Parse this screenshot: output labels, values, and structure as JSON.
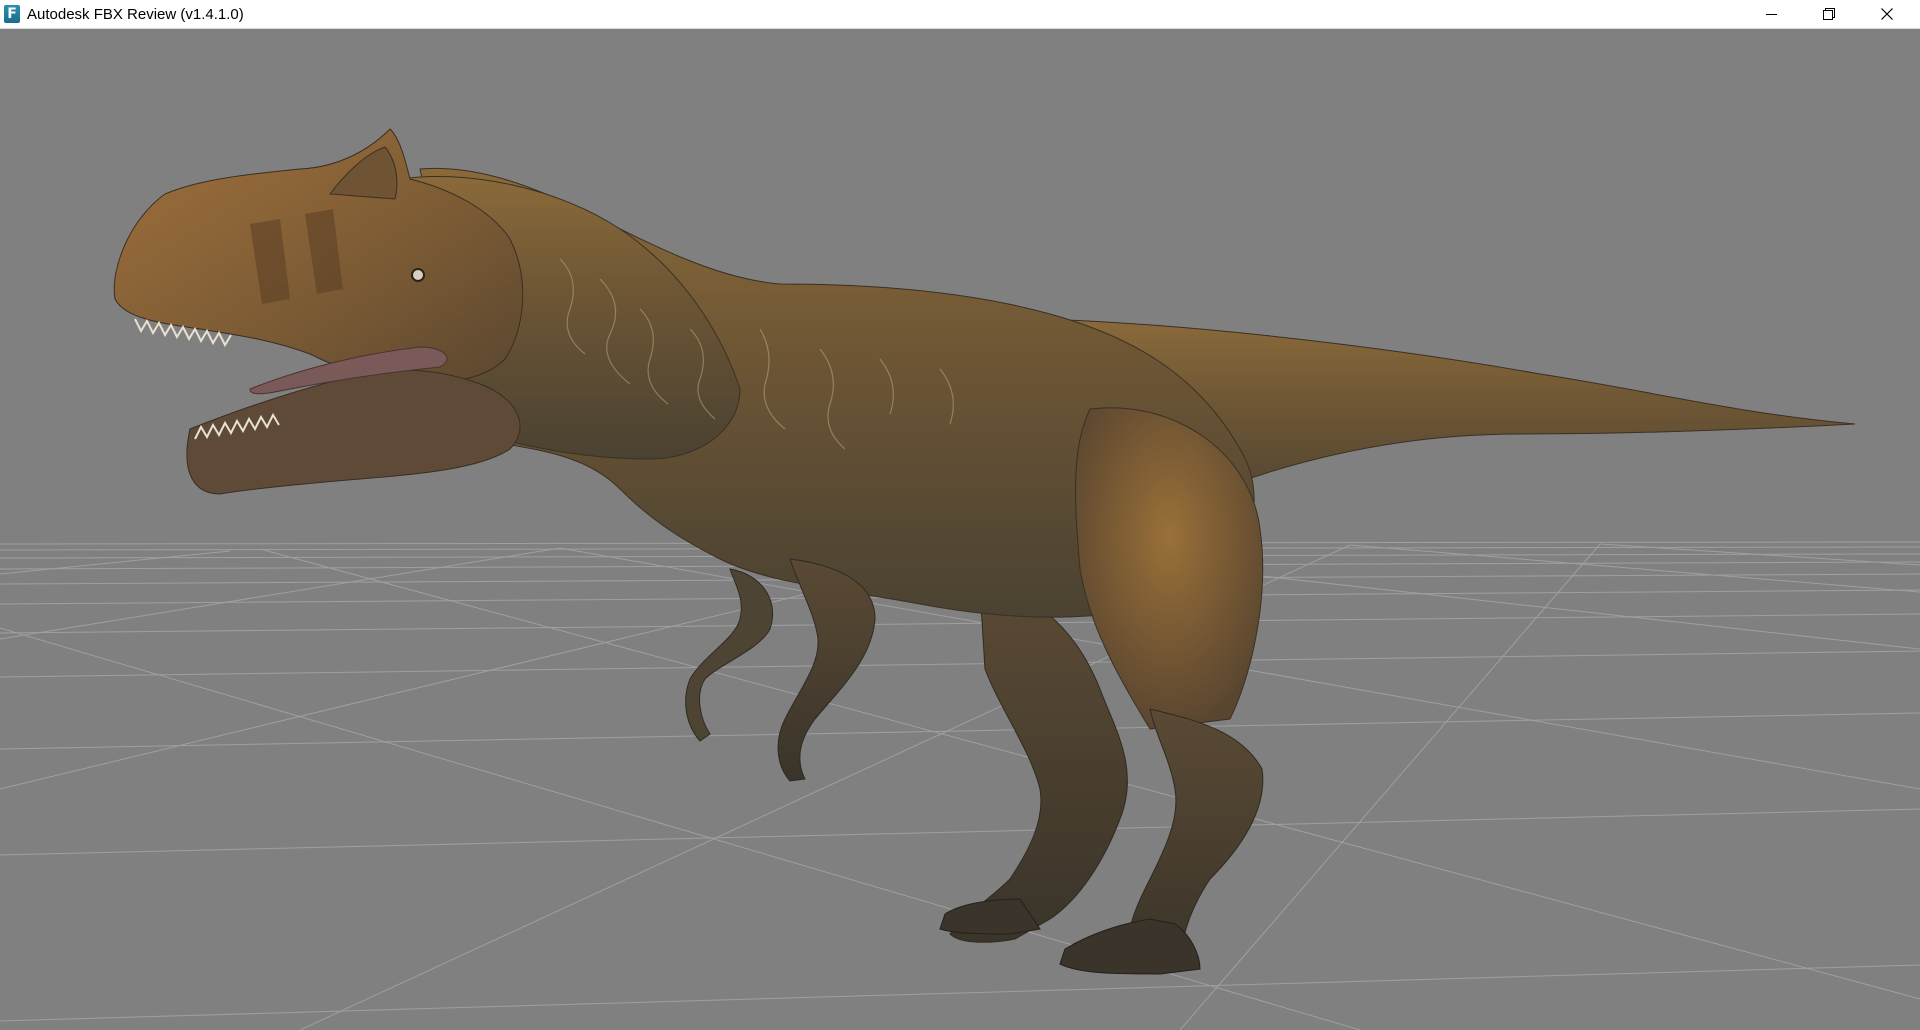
{
  "window": {
    "title": "Autodesk FBX Review (v1.4.1.0)",
    "app_icon_letter": "F",
    "icons": {
      "app": "fbx-review-app-icon",
      "minimize": "minimize-icon",
      "maximize": "restore-icon",
      "close": "close-icon"
    }
  },
  "viewport": {
    "background_color": "#808080",
    "grid_color": "#a3a3a3",
    "model": "dinosaur-3d-model"
  }
}
